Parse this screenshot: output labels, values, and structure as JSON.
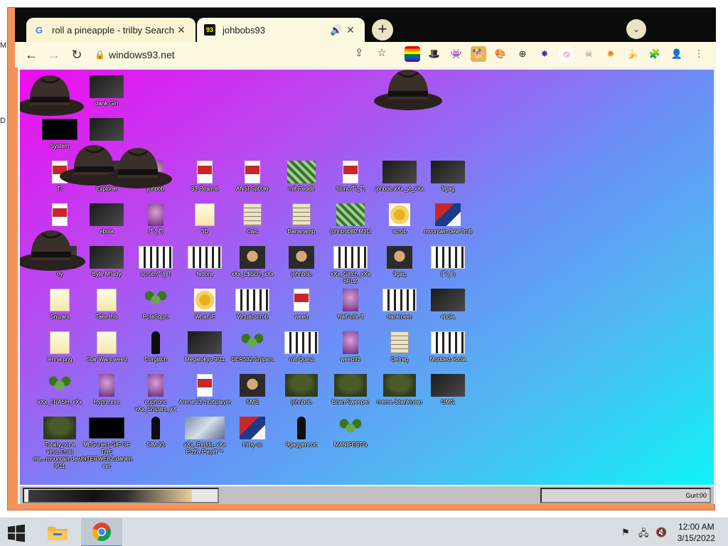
{
  "host_desktop": {
    "fragments": [
      "M",
      "D"
    ]
  },
  "browser": {
    "tabs": [
      {
        "title": "roll a pineapple - trilby Search",
        "favicon": "google-g-icon",
        "active": false
      },
      {
        "title": "johbobs93",
        "favicon": "windows93-icon",
        "active": true
      }
    ],
    "address": "windows93.net",
    "extensions": [
      "rainbow-flag-icon",
      "fedora-icon",
      "ghost-icon",
      "doge-icon",
      "pinwheel-icon",
      "compass-icon",
      "starburst-icon",
      "block-icon",
      "skull-icon",
      "sun-icon",
      "banana-icon",
      "puzzle-icon",
      "profile-icon",
      "kebab-menu-icon"
    ]
  },
  "w93": {
    "icons": [
      {
        "label": "dank Girl",
        "thumb": "img-dark"
      },
      {
        "label": "System",
        "thumb": "img-pyramid"
      },
      {
        "label": "",
        "thumb": "img-dark"
      },
      {
        "label": "Tr",
        "thumb": "img-red"
      },
      {
        "label": "Explorer",
        "thumb": "img-dark"
      },
      {
        "label": "johbob",
        "thumb": "img-purple"
      },
      {
        "label": "93 Realms",
        "thumb": "img-red"
      },
      {
        "label": "ANSI Sp00kr",
        "thumb": "img-red"
      },
      {
        "label": "m8 Reddit",
        "thumb": "img-weed"
      },
      {
        "label": "blunt (͡° ͜ʖ ͡°)",
        "thumb": "img-red"
      },
      {
        "label": "johbob.xXx_yt_xXx",
        "thumb": "img-dark"
      },
      {
        "label": "9gag",
        "thumb": "img-dark"
      },
      {
        "label": "",
        "thumb": "img-red"
      },
      {
        "label": "ebola",
        "thumb": "img-dark"
      },
      {
        "label": "(͡° ͜ʖ ͡°)",
        "thumb": "img-purple"
      },
      {
        "label": "3D",
        "thumb": "img-doc"
      },
      {
        "label": "Calc",
        "thumb": "img-calc"
      },
      {
        "label": "Bananamp",
        "thumb": "img-calc"
      },
      {
        "label": "johnbob80.M3U",
        "thumb": "img-weed"
      },
      {
        "label": "scrub",
        "thumb": "img-sun"
      },
      {
        "label": "mountain dew 3m8",
        "thumb": "img-flag"
      },
      {
        "label": "oy",
        "thumb": "img-dark"
      },
      {
        "label": "Byte M'lady",
        "thumb": "img-dark"
      },
      {
        "label": "scrub (͡° ͜ʖ ͡°)",
        "thumb": "img-people"
      },
      {
        "label": "fedora",
        "thumb": "img-people"
      },
      {
        "label": "xXx_L$SDJ_xXx",
        "thumb": "img-face"
      },
      {
        "label": "johnbob",
        "thumb": "img-face"
      },
      {
        "label": "xXx_Glitch_xXx 6RLZ",
        "thumb": "img-people"
      },
      {
        "label": "9gag",
        "thumb": "img-face"
      },
      {
        "label": "(͡° ͜ʖ ͡°)",
        "thumb": "img-people"
      },
      {
        "label": "Snipars",
        "thumb": "img-doc"
      },
      {
        "label": "Take this",
        "thumb": "img-doc"
      },
      {
        "label": "PolaSqpıɔ",
        "thumb": "img-weedleaf"
      },
      {
        "label": "What IF",
        "thumb": "img-sun"
      },
      {
        "label": "Virtual scrub",
        "thumb": "img-people"
      },
      {
        "label": "weed",
        "thumb": "img-red"
      },
      {
        "label": "Half-Life 3",
        "thumb": "img-purple"
      },
      {
        "label": "dankineer",
        "thumb": "img-people"
      },
      {
        "label": "ebola",
        "thumb": "img-dark"
      },
      {
        "label": "lenna.png",
        "thumb": "img-doc"
      },
      {
        "label": "Star Wars.weed",
        "thumb": "img-doc"
      },
      {
        "label": "Corglitch",
        "thumb": "img-figure"
      },
      {
        "label": "Megatokyo 9/11",
        "thumb": "img-dark"
      },
      {
        "label": "DER532.Snipars",
        "thumb": "img-weedleaf"
      },
      {
        "label": "m8 Quest",
        "thumb": "img-people"
      },
      {
        "label": "weed93",
        "thumb": "img-purple"
      },
      {
        "label": "Defrag",
        "thumb": "img-calc"
      },
      {
        "label": "Modded ebola",
        "thumb": "img-people"
      },
      {
        "label": "xXx_TRASH_xXx",
        "thumb": "img-weedleaf"
      },
      {
        "label": "Hydra.exe",
        "thumb": "img-purple"
      },
      {
        "label": "euphoric xXx_Snipars_xX",
        "thumb": "img-purple"
      },
      {
        "label": "Arena 93 multiplayer",
        "thumb": "img-red"
      },
      {
        "label": "SMS",
        "thumb": "img-face"
      },
      {
        "label": "johnbob",
        "thumb": "img-tree"
      },
      {
        "label": "Brian Sweeper",
        "thumb": "img-tree"
      },
      {
        "label": "meme 3dankineer",
        "thumb": "img-tree"
      },
      {
        "label": "DMG",
        "thumb": "img-dark"
      },
      {
        "label": "Totally not a virus.Trust me...mountain dew a 9/11",
        "thumb": "img-tree"
      },
      {
        "label": "MLG-inect GIF OF THE INTERWEBZ.dankineer",
        "thumb": "img-pyramid"
      },
      {
        "label": "SIM 93",
        "thumb": "img-figure"
      },
      {
        "label": "xXx_Reddit_xXx Pizza Player™",
        "thumb": "img-anime"
      },
      {
        "label": "trilby uc",
        "thumb": "img-flag"
      },
      {
        "label": "9gaggers.txt",
        "thumb": "img-figure"
      },
      {
        "label": "MANIFESTO",
        "thumb": "img-weedleaf"
      }
    ],
    "tray_text": "Gurl:00"
  },
  "os": {
    "clock_time": "12:00 AM",
    "clock_date": "3/15/2022"
  }
}
